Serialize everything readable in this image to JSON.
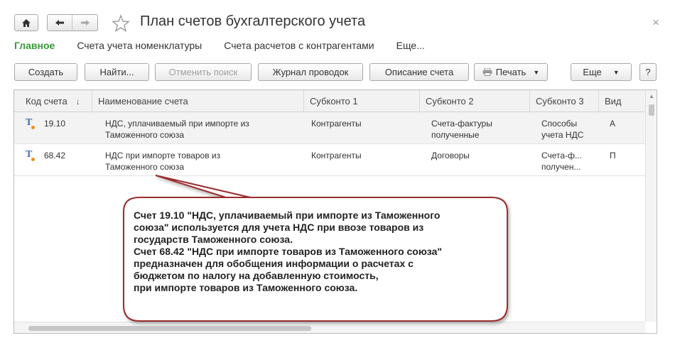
{
  "header": {
    "title": "План счетов бухгалтерского учета",
    "close": "×"
  },
  "tabs": [
    {
      "label": "Главное"
    },
    {
      "label": "Счета учета номенклатуры"
    },
    {
      "label": "Счета расчетов с контрагентами"
    },
    {
      "label": "Еще..."
    }
  ],
  "toolbar": {
    "create": "Создать",
    "find": "Найти...",
    "cancel_search": "Отменить поиск",
    "journal": "Журнал проводок",
    "description": "Описание счета",
    "print": "Печать",
    "more": "Еще",
    "help": "?"
  },
  "table": {
    "columns": [
      "Код счета",
      "Наименование счета",
      "Субконто 1",
      "Субконто 2",
      "Субконто 3",
      "Вид"
    ],
    "sort_indicator": "↓",
    "rows": [
      {
        "code": "19.10",
        "name1": "НДС, уплачиваемый при импорте из",
        "name2": "Таможенного союза",
        "sub1": "Контрагенты",
        "sub2a": "Счета-фактуры",
        "sub2b": "полученные",
        "sub3a": "Способы",
        "sub3b": "учета НДС",
        "kind": "А"
      },
      {
        "code": "68.42",
        "name1": "НДС при импорте товаров из",
        "name2": "Таможенного союза",
        "sub1": "Контрагенты",
        "sub2a": "Договоры",
        "sub2b": "",
        "sub3a": "Счета-ф...",
        "sub3b": "получен...",
        "kind": "П"
      }
    ]
  },
  "callout": {
    "lines": [
      "Счет 19.10 \"НДС, уплачиваемый при импорте из Таможенного",
      "союза\" используется для учета НДС при ввозе товаров из",
      "государств Таможенного союза.",
      "Счет 68.42 \"НДС при импорте товаров из Таможенного союза\"",
      "предназначен для обобщения информации о расчетах с",
      "бюджетом по налогу на добавленную стоимость,",
      "при импорте товаров из Таможенного союза."
    ],
    "border_color": "#9b2d2d"
  },
  "colors": {
    "active_tab": "#3a9a3a"
  }
}
